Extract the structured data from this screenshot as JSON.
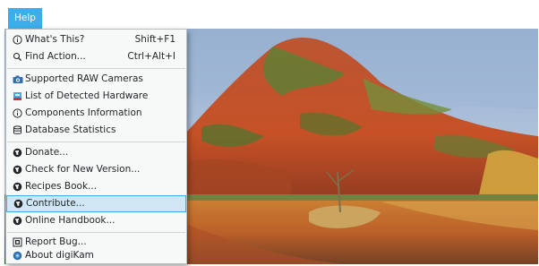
{
  "menubar": {
    "help_label": "Help"
  },
  "menu": {
    "items": [
      {
        "label": "What's This?",
        "shortcut": "Shift+F1",
        "icon": "info-icon"
      },
      {
        "label": "Find Action...",
        "shortcut": "Ctrl+Alt+I",
        "icon": "search-icon"
      },
      {
        "label": "Supported RAW Cameras",
        "icon": "camera-icon"
      },
      {
        "label": "List of Detected Hardware",
        "icon": "hardware-icon"
      },
      {
        "label": "Components Information",
        "icon": "info-icon"
      },
      {
        "label": "Database Statistics",
        "icon": "database-icon"
      },
      {
        "label": "Donate...",
        "icon": "globe-icon"
      },
      {
        "label": "Check for New Version...",
        "icon": "globe-icon"
      },
      {
        "label": "Recipes Book...",
        "icon": "globe-icon"
      },
      {
        "label": "Contribute...",
        "icon": "globe-icon",
        "highlighted": true
      },
      {
        "label": "Online Handbook...",
        "icon": "globe-icon"
      },
      {
        "label": "Report Bug...",
        "icon": "bug-icon"
      },
      {
        "label": "About digiKam",
        "icon": "digikam-logo-icon"
      }
    ]
  },
  "colors": {
    "accent": "#3daee9",
    "highlight_bg": "#cfe7f5",
    "menu_bg": "#f7f8f8"
  }
}
